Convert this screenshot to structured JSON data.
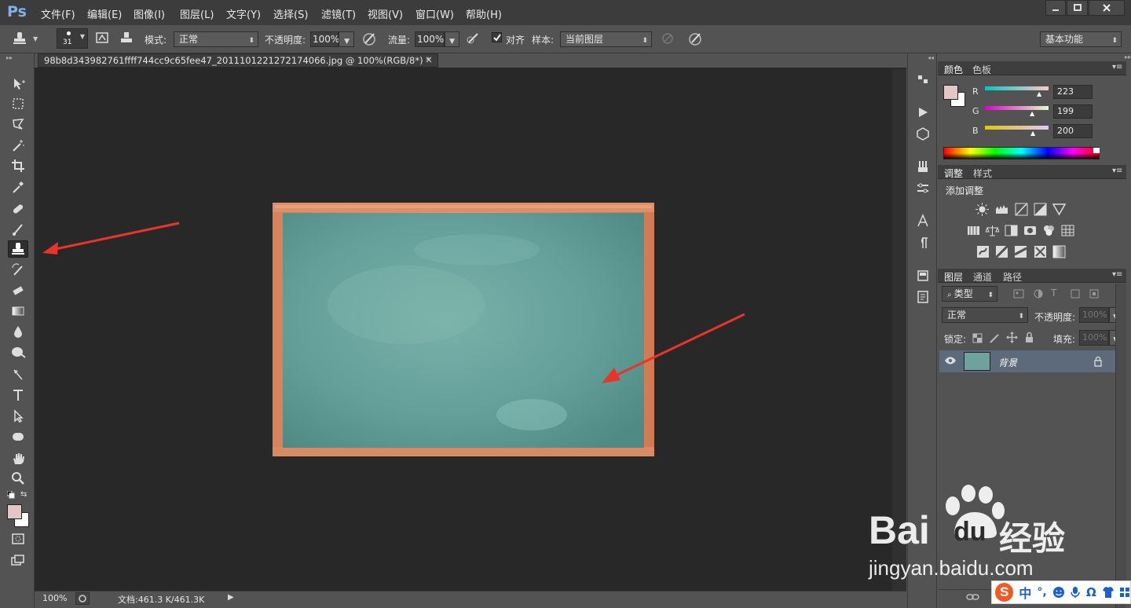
{
  "app": {
    "logo": "Ps"
  },
  "menu": [
    "文件(F)",
    "编辑(E)",
    "图像(I)",
    "图层(L)",
    "文字(Y)",
    "选择(S)",
    "滤镜(T)",
    "视图(V)",
    "窗口(W)",
    "帮助(H)"
  ],
  "options": {
    "brush_size": "31",
    "mode_label": "模式:",
    "mode_value": "正常",
    "opacity_label": "不透明度:",
    "opacity_value": "100%",
    "flow_label": "流量:",
    "flow_value": "100%",
    "aligned_label": "对齐",
    "sample_label": "样本:",
    "sample_value": "当前图层",
    "workspace": "基本功能"
  },
  "document": {
    "tab_title": "98b8d343982761ffff744cc9c65fee47_20111012212721740­66.jpg @ 100%(RGB/8*) *",
    "close_glyph": "×"
  },
  "status": {
    "zoom": "100%",
    "doc_info": "文档:461.3 K/461.3K"
  },
  "color_panel": {
    "tabs": [
      "颜色",
      "色板"
    ],
    "fg_color": "#e3c7c8",
    "channels": [
      {
        "name": "R",
        "value": "223"
      },
      {
        "name": "G",
        "value": "199"
      },
      {
        "name": "B",
        "value": "200"
      }
    ]
  },
  "adjust_panel": {
    "tabs": [
      "调整",
      "样式"
    ],
    "title": "添加调整"
  },
  "layers_panel": {
    "tabs": [
      "图层",
      "通道",
      "路径"
    ],
    "filter_kind": "类型",
    "blend_mode": "正常",
    "opacity_label": "不透明度:",
    "opacity_value": "100%",
    "lock_label": "锁定:",
    "fill_label": "填充:",
    "fill_value": "100%",
    "layers": [
      {
        "name": "背景"
      }
    ]
  },
  "watermark": {
    "brand": "Bai",
    "brand2": "du",
    "cn": "经验",
    "url": "jingyan.baidu.com"
  },
  "ime": {
    "mode": "中"
  }
}
